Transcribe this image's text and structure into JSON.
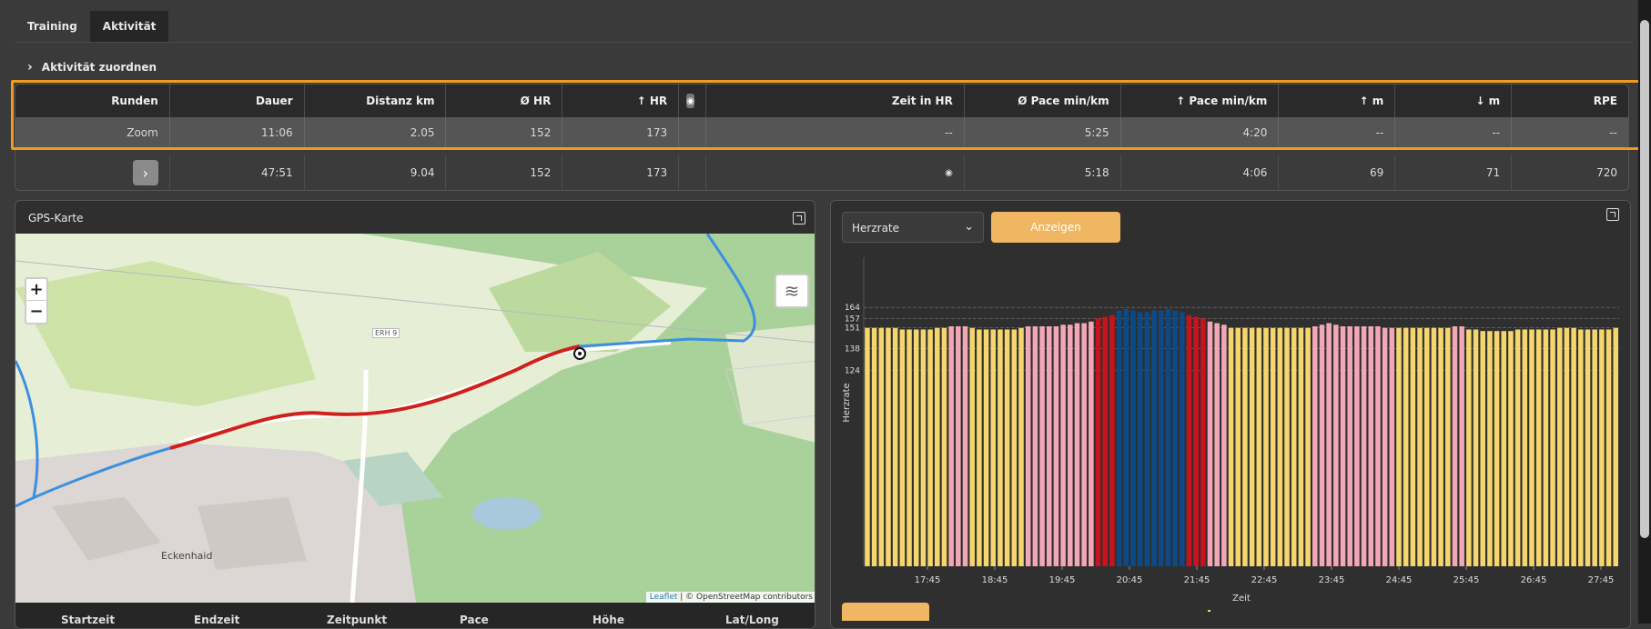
{
  "tabs": [
    {
      "label": "Training"
    },
    {
      "label": "Aktivität"
    }
  ],
  "assign_label": "Aktivität zuordnen",
  "laps_table": {
    "headers": [
      "Runden",
      "Dauer",
      "Distanz km",
      "Ø HR",
      "↑ HR",
      "",
      "Zeit in HR",
      "Ø Pace min/km",
      "↑ Pace min/km",
      "↑ m",
      "↓ m",
      "RPE"
    ],
    "zoom_row": [
      "Zoom",
      "11:06",
      "2.05",
      "152",
      "173",
      "",
      "--",
      "5:25",
      "4:20",
      "--",
      "--",
      "--"
    ],
    "total_row": [
      "",
      "47:51",
      "9.04",
      "152",
      "173",
      "",
      "",
      "5:18",
      "4:06",
      "69",
      "71",
      "720"
    ]
  },
  "map": {
    "title": "GPS-Karte",
    "zoom_in": "+",
    "zoom_out": "−",
    "attribution_leaflet": "Leaflet",
    "attribution_rest": " | © OpenStreetMap contributors",
    "place_labels": [
      "ERH 9",
      "Eckenhaid"
    ],
    "footer_labels": [
      "Startzeit",
      "Endzeit",
      "Zeitpunkt",
      "Pace",
      "Höhe",
      "Lat/Long"
    ]
  },
  "chart_panel": {
    "select_value": "Herzrate",
    "show_button": "Anzeigen"
  },
  "chart_data": {
    "type": "bar",
    "xlabel": "Zeit",
    "ylabel": "Herzrate",
    "legend": [
      "Herzrate"
    ],
    "y_ticks": [
      124,
      138,
      151,
      157,
      164
    ],
    "x_ticks": [
      "17:45",
      "18:45",
      "19:45",
      "20:45",
      "21:45",
      "22:45",
      "23:45",
      "24:45",
      "25:45",
      "26:45",
      "27:45"
    ],
    "colors": {
      "yellow": "#f5d66e",
      "pink": "#f2a7b6",
      "red": "#c8131f",
      "blue": "#0d4a85"
    },
    "bars": [
      [
        151,
        "yellow"
      ],
      [
        151,
        "yellow"
      ],
      [
        151,
        "yellow"
      ],
      [
        151,
        "yellow"
      ],
      [
        151,
        "yellow"
      ],
      [
        150,
        "yellow"
      ],
      [
        150,
        "yellow"
      ],
      [
        150,
        "yellow"
      ],
      [
        150,
        "yellow"
      ],
      [
        150,
        "yellow"
      ],
      [
        151,
        "yellow"
      ],
      [
        151,
        "yellow"
      ],
      [
        152,
        "pink"
      ],
      [
        152,
        "pink"
      ],
      [
        152,
        "pink"
      ],
      [
        151,
        "yellow"
      ],
      [
        150,
        "yellow"
      ],
      [
        150,
        "yellow"
      ],
      [
        150,
        "yellow"
      ],
      [
        150,
        "yellow"
      ],
      [
        150,
        "yellow"
      ],
      [
        150,
        "yellow"
      ],
      [
        151,
        "yellow"
      ],
      [
        152,
        "pink"
      ],
      [
        152,
        "pink"
      ],
      [
        152,
        "pink"
      ],
      [
        152,
        "pink"
      ],
      [
        152,
        "pink"
      ],
      [
        153,
        "pink"
      ],
      [
        153,
        "pink"
      ],
      [
        154,
        "pink"
      ],
      [
        154,
        "pink"
      ],
      [
        155,
        "pink"
      ],
      [
        157,
        "red"
      ],
      [
        158,
        "red"
      ],
      [
        159,
        "red"
      ],
      [
        162,
        "blue"
      ],
      [
        163,
        "blue"
      ],
      [
        162,
        "blue"
      ],
      [
        161,
        "blue"
      ],
      [
        161,
        "blue"
      ],
      [
        162,
        "blue"
      ],
      [
        162,
        "blue"
      ],
      [
        163,
        "blue"
      ],
      [
        162,
        "blue"
      ],
      [
        161,
        "blue"
      ],
      [
        159,
        "red"
      ],
      [
        158,
        "red"
      ],
      [
        157,
        "red"
      ],
      [
        155,
        "pink"
      ],
      [
        154,
        "pink"
      ],
      [
        153,
        "pink"
      ],
      [
        151,
        "yellow"
      ],
      [
        151,
        "yellow"
      ],
      [
        151,
        "yellow"
      ],
      [
        151,
        "yellow"
      ],
      [
        151,
        "yellow"
      ],
      [
        151,
        "yellow"
      ],
      [
        151,
        "yellow"
      ],
      [
        151,
        "yellow"
      ],
      [
        151,
        "yellow"
      ],
      [
        151,
        "yellow"
      ],
      [
        151,
        "yellow"
      ],
      [
        151,
        "yellow"
      ],
      [
        152,
        "pink"
      ],
      [
        153,
        "pink"
      ],
      [
        154,
        "pink"
      ],
      [
        153,
        "pink"
      ],
      [
        152,
        "pink"
      ],
      [
        152,
        "pink"
      ],
      [
        152,
        "pink"
      ],
      [
        152,
        "pink"
      ],
      [
        152,
        "pink"
      ],
      [
        152,
        "pink"
      ],
      [
        151,
        "pink"
      ],
      [
        151,
        "pink"
      ],
      [
        151,
        "yellow"
      ],
      [
        151,
        "yellow"
      ],
      [
        151,
        "yellow"
      ],
      [
        151,
        "yellow"
      ],
      [
        151,
        "yellow"
      ],
      [
        151,
        "yellow"
      ],
      [
        151,
        "yellow"
      ],
      [
        151,
        "yellow"
      ],
      [
        152,
        "pink"
      ],
      [
        152,
        "pink"
      ],
      [
        150,
        "yellow"
      ],
      [
        150,
        "yellow"
      ],
      [
        149,
        "yellow"
      ],
      [
        149,
        "yellow"
      ],
      [
        149,
        "yellow"
      ],
      [
        149,
        "yellow"
      ],
      [
        149,
        "yellow"
      ],
      [
        150,
        "yellow"
      ],
      [
        150,
        "yellow"
      ],
      [
        150,
        "yellow"
      ],
      [
        150,
        "yellow"
      ],
      [
        150,
        "yellow"
      ],
      [
        150,
        "yellow"
      ],
      [
        151,
        "yellow"
      ],
      [
        151,
        "yellow"
      ],
      [
        151,
        "yellow"
      ],
      [
        150,
        "yellow"
      ],
      [
        150,
        "yellow"
      ],
      [
        150,
        "yellow"
      ],
      [
        150,
        "yellow"
      ],
      [
        150,
        "yellow"
      ],
      [
        151,
        "yellow"
      ]
    ]
  }
}
